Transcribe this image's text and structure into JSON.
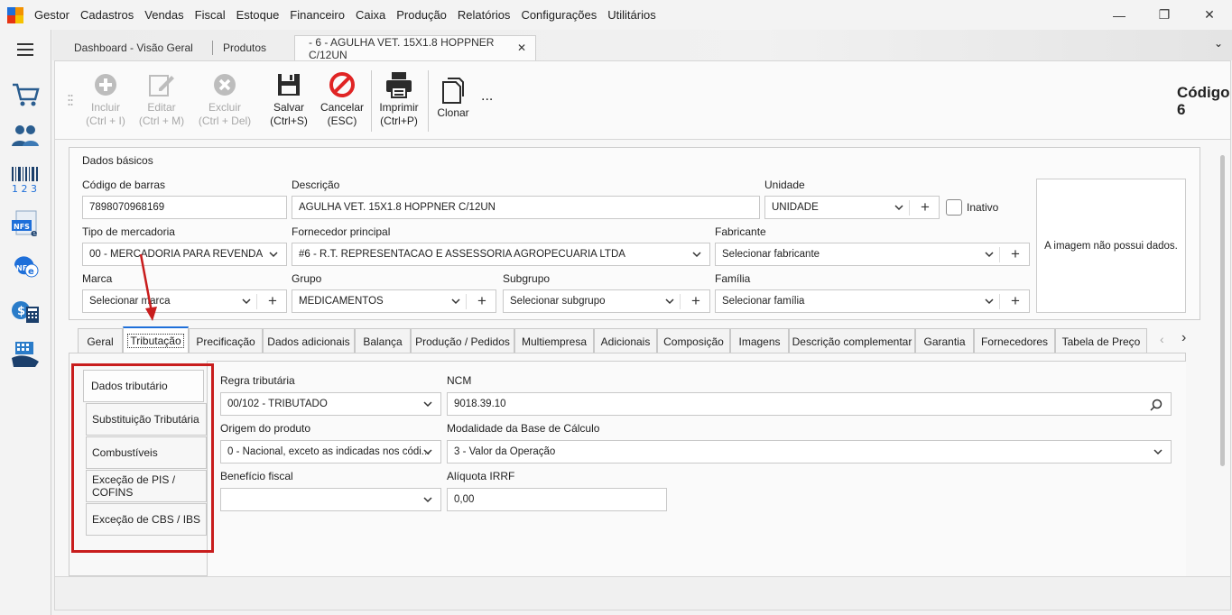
{
  "menu": {
    "app": "Gestor",
    "items": [
      "Cadastros",
      "Vendas",
      "Fiscal",
      "Estoque",
      "Financeiro",
      "Caixa",
      "Produção",
      "Relatórios",
      "Configurações",
      "Utilitários"
    ]
  },
  "doc_tabs": [
    "Dashboard - Visão Geral",
    "Produtos",
    "- 6 - AGULHA VET. 15X1.8 HOPPNER C/12UN"
  ],
  "toolbar": {
    "incluir": [
      "Incluir",
      "(Ctrl + I)"
    ],
    "editar": [
      "Editar",
      "(Ctrl + M)"
    ],
    "excluir": [
      "Excluir",
      "(Ctrl + Del)"
    ],
    "salvar": [
      "Salvar",
      "(Ctrl+S)"
    ],
    "cancelar": [
      "Cancelar",
      "(ESC)"
    ],
    "imprimir": [
      "Imprimir",
      "(Ctrl+P)"
    ],
    "clonar": "Clonar",
    "more": "...",
    "codigo_label": "Código",
    "codigo_value": "6"
  },
  "dados_basicos": {
    "title": "Dados básicos",
    "codigo_barras_label": "Código de barras",
    "codigo_barras": "7898070968169",
    "descricao_label": "Descrição",
    "descricao": "AGULHA VET. 15X1.8 HOPPNER C/12UN",
    "unidade_label": "Unidade",
    "unidade": "UNIDADE",
    "inativo_label": "Inativo",
    "tipo_label": "Tipo de mercadoria",
    "tipo": "00 - MERCADORIA PARA REVENDA",
    "fornecedor_label": "Fornecedor principal",
    "fornecedor": "#6 - R.T. REPRESENTACAO E ASSESSORIA AGROPECUARIA LTDA",
    "fabricante_label": "Fabricante",
    "fabricante": "Selecionar fabricante",
    "marca_label": "Marca",
    "marca": "Selecionar marca",
    "grupo_label": "Grupo",
    "grupo": "MEDICAMENTOS",
    "subgrupo_label": "Subgrupo",
    "subgrupo": "Selecionar subgrupo",
    "familia_label": "Família",
    "familia": "Selecionar família",
    "imagem_text": "A imagem não possui dados."
  },
  "sub_tabs": [
    "Geral",
    "Tributação",
    "Precificação",
    "Dados adicionais",
    "Balança",
    "Produção / Pedidos",
    "Multiempresa",
    "Adicionais",
    "Composição",
    "Imagens",
    "Descrição complementar",
    "Garantia",
    "Fornecedores",
    "Tabela de Preço"
  ],
  "vertical_tabs": [
    "Dados tributário",
    "Substituição Tributária",
    "Combustíveis",
    "Exceção de PIS / COFINS",
    "Exceção de CBS / IBS"
  ],
  "tributacao": {
    "regra_label": "Regra tributária",
    "regra": "00/102 - TRIBUTADO",
    "ncm_label": "NCM",
    "ncm": "9018.39.10",
    "origem_label": "Origem do produto",
    "origem": "0 - Nacional, exceto as indicadas nos códi...",
    "modalidade_label": "Modalidade da Base de Cálculo",
    "modalidade": "3 - Valor da Operação",
    "beneficio_label": "Benefício fiscal",
    "beneficio": "",
    "aliquota_label": "Alíquota IRRF",
    "aliquota": "0,00"
  },
  "colors": {
    "annotation_red": "#c81d1d",
    "active_tab_accent": "#1e6fd9"
  }
}
